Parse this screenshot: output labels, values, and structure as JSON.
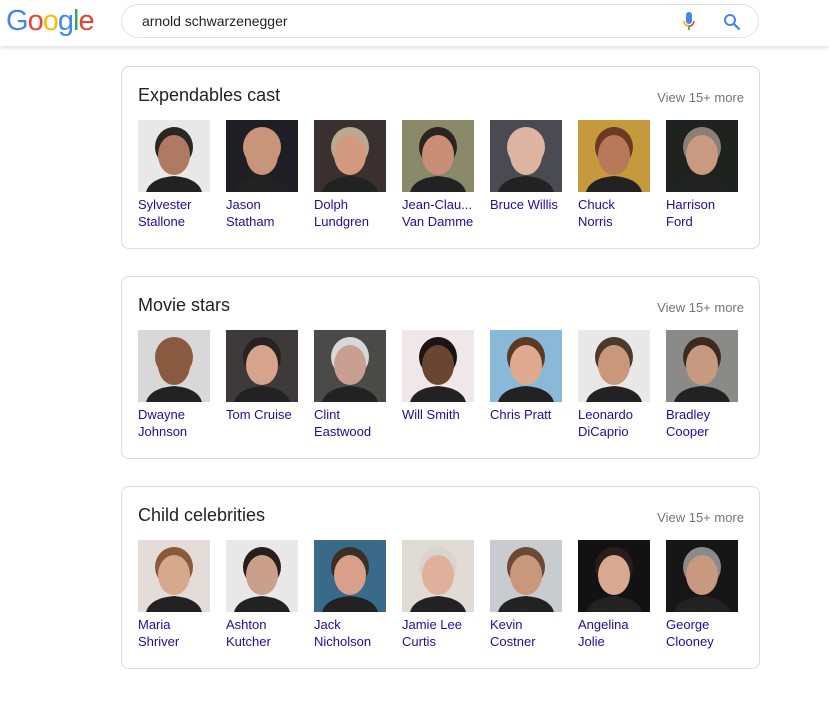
{
  "header": {
    "logo_letters": [
      {
        "char": "G",
        "color": "#4285f4"
      },
      {
        "char": "o",
        "color": "#ea4335"
      },
      {
        "char": "o",
        "color": "#fbbc05"
      },
      {
        "char": "g",
        "color": "#4285f4"
      },
      {
        "char": "l",
        "color": "#34a853"
      },
      {
        "char": "e",
        "color": "#ea4335"
      }
    ],
    "search_query": "arnold schwarzenegger",
    "mic_icon": "microphone-icon",
    "search_icon": "magnifier-icon"
  },
  "cards": [
    {
      "title": "Expendables cast",
      "view_more": "View 15+ more",
      "items": [
        {
          "name": "Sylvester Stallone",
          "bg": "#e8e8e8",
          "skin": "#b07a62",
          "hair": "#2a2622"
        },
        {
          "name": "Jason Statham",
          "bg": "#1d1f24",
          "skin": "#c9957a",
          "hair": "#c9957a"
        },
        {
          "name": "Dolph Lundgren",
          "bg": "#3a3030",
          "skin": "#d49a80",
          "hair": "#b9a98f"
        },
        {
          "name": "Jean-Clau... Van Damme",
          "bg": "#8a8a6a",
          "skin": "#c98f76",
          "hair": "#2b2420"
        },
        {
          "name": "Bruce Willis",
          "bg": "#4a4a52",
          "skin": "#dcb4a0",
          "hair": "#dcb4a0"
        },
        {
          "name": "Chuck Norris",
          "bg": "#c69a3c",
          "skin": "#b8785a",
          "hair": "#6a3a22"
        },
        {
          "name": "Harrison Ford",
          "bg": "#1f2320",
          "skin": "#c99a80",
          "hair": "#8a8078"
        }
      ]
    },
    {
      "title": "Movie stars",
      "view_more": "View 15+ more",
      "items": [
        {
          "name": "Dwayne Johnson",
          "bg": "#d8d8d8",
          "skin": "#8a5a40",
          "hair": "#8a5a40"
        },
        {
          "name": "Tom Cruise",
          "bg": "#3e3a3a",
          "skin": "#d6a48a",
          "hair": "#2a2220"
        },
        {
          "name": "Clint Eastwood",
          "bg": "#4a4a48",
          "skin": "#c9a090",
          "hair": "#d8d8d8"
        },
        {
          "name": "Will Smith",
          "bg": "#f0e8e8",
          "skin": "#6a4632",
          "hair": "#1a1412"
        },
        {
          "name": "Chris Pratt",
          "bg": "#8ab8d8",
          "skin": "#e0aa90",
          "hair": "#5a3a22"
        },
        {
          "name": "Leonardo DiCaprio",
          "bg": "#e8e8e8",
          "skin": "#c9987a",
          "hair": "#4a3a2a"
        },
        {
          "name": "Bradley Cooper",
          "bg": "#8a8a88",
          "skin": "#c79a80",
          "hair": "#3a2a22"
        }
      ]
    },
    {
      "title": "Child celebrities",
      "view_more": "View 15+ more",
      "items": [
        {
          "name": "Maria Shriver",
          "bg": "#e4dcd8",
          "skin": "#d6a88c",
          "hair": "#8a5a38"
        },
        {
          "name": "Ashton Kutcher",
          "bg": "#e8e8e8",
          "skin": "#caa08a",
          "hair": "#2a1e1a"
        },
        {
          "name": "Jack Nicholson",
          "bg": "#3a6a8a",
          "skin": "#d8a08a",
          "hair": "#3a3028"
        },
        {
          "name": "Jamie Lee Curtis",
          "bg": "#e0dcd4",
          "skin": "#e0b09a",
          "hair": "#d8d4d0"
        },
        {
          "name": "Kevin Costner",
          "bg": "#c8ccd0",
          "skin": "#c9977a",
          "hair": "#6a4a32"
        },
        {
          "name": "Angelina Jolie",
          "bg": "#121214",
          "skin": "#d8a890",
          "hair": "#2a1e18"
        },
        {
          "name": "George Clooney",
          "bg": "#161616",
          "skin": "#c99880",
          "hair": "#8a8a88"
        }
      ]
    }
  ]
}
